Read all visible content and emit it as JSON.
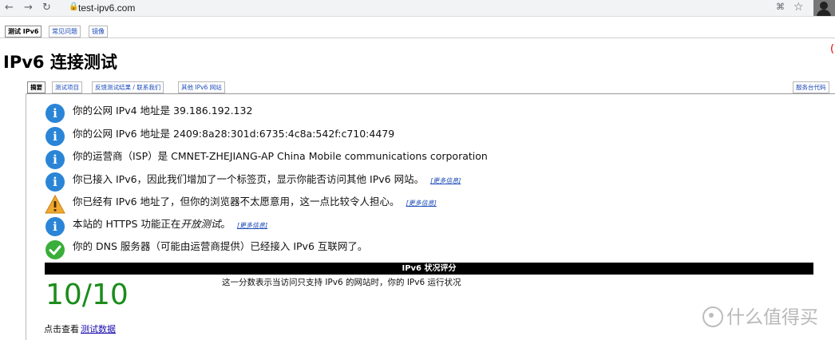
{
  "browser": {
    "url": "test-ipv6.com"
  },
  "top_tabs": [
    "测试 IPv6",
    "常见问题",
    "镜像"
  ],
  "page_title": "IPv6 连接测试",
  "sub_tabs": [
    "摘要",
    "测试项目",
    "反馈测试结果 / 联系我们",
    "其他 IPv6 网站"
  ],
  "sub_tab_right": "服务台代码",
  "messages": [
    {
      "icon": "info-icon",
      "text": "你的公网 IPv4 地址是 39.186.192.132",
      "more": ""
    },
    {
      "icon": "info-icon",
      "text": "你的公网 IPv6 地址是 2409:8a28:301d:6735:4c8a:542f:c710:4479",
      "more": ""
    },
    {
      "icon": "info-icon",
      "text": "你的运营商（ISP）是 CMNET-ZHEJIANG-AP China Mobile communications corporation",
      "more": ""
    },
    {
      "icon": "info-icon",
      "text": "你已接入 IPv6，因此我们增加了一个标签页，显示你能否访问其他 IPv6 网站。",
      "more": "[更多信息]"
    },
    {
      "icon": "warning-icon",
      "text": "你已经有 IPv6 地址了，但你的浏览器不太愿意用，这一点比较令人担心。",
      "more": "[更多信息]"
    },
    {
      "icon": "info-icon",
      "text_prefix": "本站的 HTTPS 功能正在",
      "text_em": "开放测试",
      "text_suffix": "。",
      "more": "[更多信息]"
    },
    {
      "icon": "check-icon",
      "text": "你的 DNS 服务器（可能由运营商提供）已经接入 IPv6 互联网了。",
      "more": ""
    }
  ],
  "score": {
    "header": "IPv6 状况评分",
    "value": "10/10",
    "description": "这一分数表示当访问只支持 IPv6 的网站时，你的 IPv6 运行状况"
  },
  "view_data": {
    "prefix": "点击查看",
    "link": "测试数据"
  },
  "watermark": "什么值得买",
  "colors": {
    "info": "#2a85d7",
    "warning": "#f0a830",
    "success": "#3aae3a",
    "score_value": "#1b8c1b"
  }
}
